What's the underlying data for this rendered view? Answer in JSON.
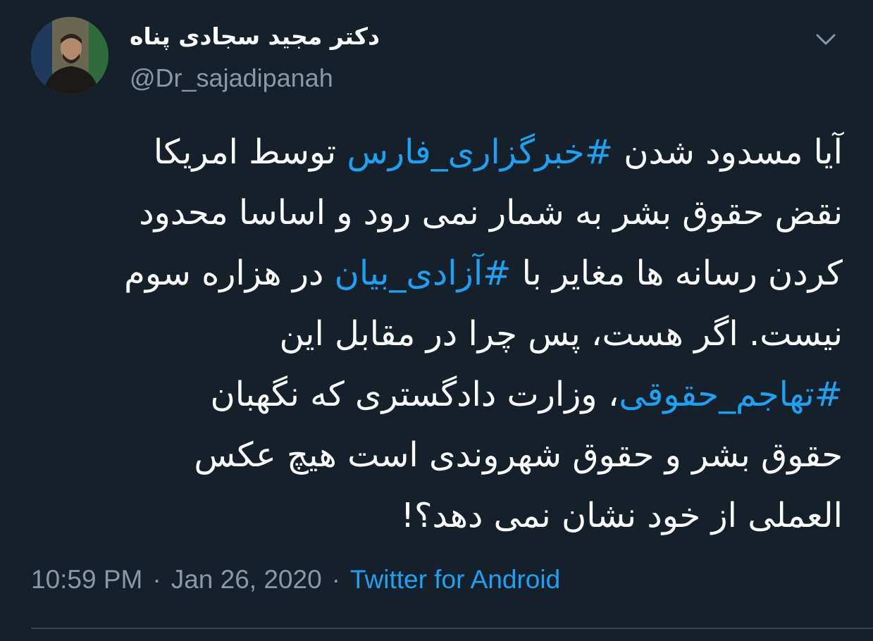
{
  "author": {
    "name": "دکتر مجید سجادی پناه",
    "handle": "@Dr_sajadipanah",
    "avatar_icon": "profile-photo"
  },
  "menu": {
    "icon": "chevron-down-icon"
  },
  "tweet": {
    "line1": {
      "pre": "آیا مسدود شدن ",
      "hashtag": "#خبرگزاری_فارس",
      "post": " توسط امریکا"
    },
    "line2": "نقض حقوق بشر به شمار نمی رود و اساسا محدود",
    "line3": {
      "pre": "کردن رسانه ها مغایر با ",
      "hashtag": "#آزادی_بیان",
      "post": " در هزاره سوم"
    },
    "line4": "نیست. اگر هست، پس چرا در مقابل این",
    "line5": {
      "hashtag": "#تهاجم_حقوقی",
      "post": "، وزارت دادگستری که نگهبان"
    },
    "line6": "حقوق بشر و حقوق شهروندی است هیچ عکس",
    "line7": "العملی از خود نشان نمی دهد؟!"
  },
  "meta": {
    "time": "10:59 PM",
    "date": "Jan 26, 2020",
    "separator": "·",
    "source": "Twitter for Android"
  },
  "colors": {
    "background": "#15202b",
    "text": "#ffffff",
    "secondary": "#8899a6",
    "link": "#1da1f2",
    "divider": "#38444d"
  }
}
